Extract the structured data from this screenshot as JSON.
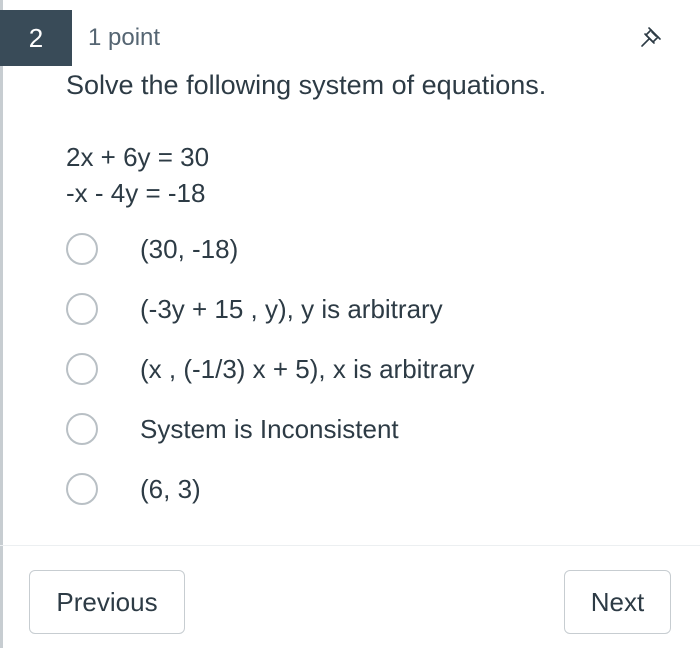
{
  "question": {
    "number": "2",
    "points": "1 point",
    "prompt": "Solve the following system of equations.",
    "equations": [
      "2x + 6y = 30",
      "-x - 4y = -18"
    ]
  },
  "options": [
    {
      "label": "(30, -18)",
      "selected": false
    },
    {
      "label": "(-3y + 15 , y), y is arbitrary",
      "selected": false
    },
    {
      "label": "(x , (-1/3) x + 5), x is arbitrary",
      "selected": false
    },
    {
      "label": "System is Inconsistent",
      "selected": false
    },
    {
      "label": "(6, 3)",
      "selected": false
    }
  ],
  "nav": {
    "previous_label": "Previous",
    "next_label": "Next"
  },
  "icons": {
    "pin": "pin-icon"
  },
  "colors": {
    "badge_bg": "#394b58",
    "text": "#2d3b45",
    "radio_border": "#b9c0c5"
  }
}
